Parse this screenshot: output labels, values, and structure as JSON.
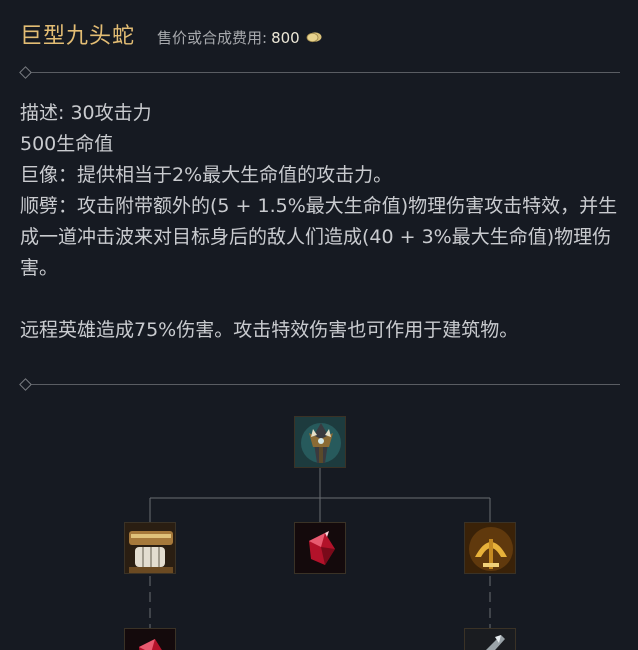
{
  "item": {
    "name": "巨型九头蛇",
    "cost_label": "售价或合成费用:",
    "cost_value": "800"
  },
  "description": [
    "描述: 30攻击力",
    "500生命值",
    "巨像：提供相当于2%最大生命值的攻击力。",
    "顺劈：攻击附带额外的(5 + 1.5%最大生命值)物理伤害攻击特效，并生成一道冲击波来对目标身后的敌人们造成(40 + 3%最大生命值)物理伤害。",
    "",
    "远程英雄造成75%伤害。攻击特效伤害也可作用于建筑物。"
  ],
  "recipe_tree": {
    "root_icon": "titanic-hydra-icon",
    "components": [
      "gauntlet-component-icon",
      "ruby-crystal-icon",
      "gold-blade-component-icon"
    ],
    "sub_components": [
      "ruby-crystal-sub-icon",
      "blade-sub-icon"
    ]
  },
  "colors": {
    "name": "#e3bd74",
    "text": "#c9cbcf",
    "background": "#161a22",
    "divider": "#5a5d63"
  }
}
